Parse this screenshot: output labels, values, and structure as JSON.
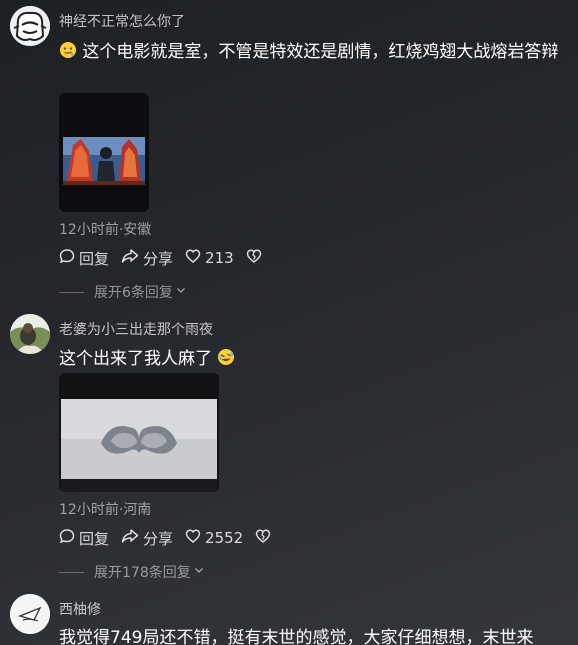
{
  "comments": [
    {
      "username": "神经不正常怎么你了",
      "text": "这个电影就是室，不管是特效还是剧情，红烧鸡翅大战熔岩答辩",
      "meta": "12小时前·安徽",
      "reply_label": "回复",
      "share_label": "分享",
      "likes": "213",
      "expand_label": "展开6条回复"
    },
    {
      "username": "老婆为小三出走那个雨夜",
      "text": "这个出来了我人麻了",
      "meta": "12小时前·河南",
      "reply_label": "回复",
      "share_label": "分享",
      "likes": "2552",
      "expand_label": "展开178条回复"
    },
    {
      "username": "西柚修",
      "text": "我觉得749局还不错，挺有末世的感觉，大家仔细想想，末世来"
    }
  ],
  "icons": {
    "emoji_1": "drooling-face-icon",
    "emoji_2": "rolling-laughing-icon",
    "reply": "comment-bubble-icon",
    "share": "share-arrow-icon",
    "like": "heart-outline-icon",
    "dislike": "broken-heart-icon",
    "expand": "chevron-down-icon"
  }
}
